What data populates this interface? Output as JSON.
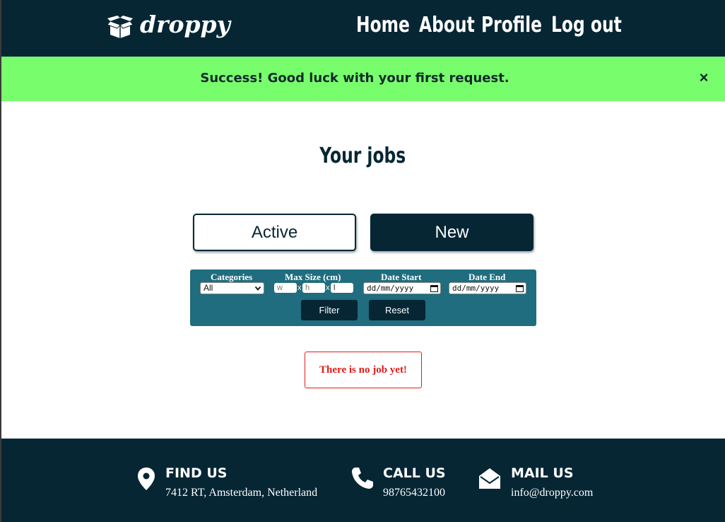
{
  "navbar": {
    "brand": "droppy",
    "links": {
      "home": "Home",
      "about": "About",
      "profile": "Profile",
      "logout": "Log out"
    }
  },
  "alert": {
    "message": "Success! Good luck with your first request.",
    "close_glyph": "×",
    "color": "#78fd6d"
  },
  "page": {
    "title": "Your jobs"
  },
  "tabs": {
    "active_label": "Active",
    "new_label": "New"
  },
  "filter": {
    "categories_label": "Categories",
    "categories_selected": "All",
    "max_size_label": "Max Size (cm)",
    "width_placeholder": "w",
    "height_placeholder": "h",
    "length_value": "l",
    "separator": "x",
    "date_start_label": "Date Start",
    "date_end_label": "Date End",
    "date_placeholder": "dd/mm/yyyy",
    "filter_button": "Filter",
    "reset_button": "Reset"
  },
  "empty_state": {
    "message": "There is no job yet!"
  },
  "footer": {
    "find": {
      "heading": "FIND US",
      "text": "7412 RT, Amsterdam, Netherland"
    },
    "call": {
      "heading": "CALL US",
      "text": "98765432100"
    },
    "mail": {
      "heading": "MAIL US",
      "text": "info@droppy.com"
    }
  },
  "colors": {
    "navy": "#062634",
    "teal": "#1f6d7f",
    "success": "#78fd6d",
    "error": "#e21b1b"
  }
}
